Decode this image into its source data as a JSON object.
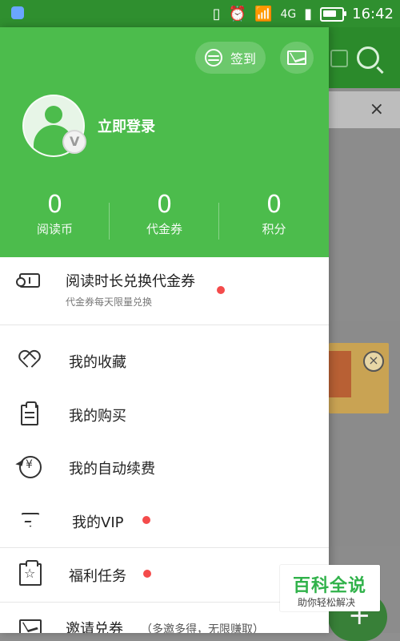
{
  "status_bar": {
    "network": "4G",
    "time": "16:42"
  },
  "drawer": {
    "sign_in_label": "签到",
    "login_label": "立即登录",
    "stats": [
      {
        "value": "0",
        "label": "阅读币"
      },
      {
        "value": "0",
        "label": "代金券"
      },
      {
        "value": "0",
        "label": "积分"
      }
    ],
    "menu": {
      "exchange": {
        "title": "阅读时长兑换代金券",
        "subtitle": "代金券每天限量兑换"
      },
      "items": [
        {
          "label": "我的收藏"
        },
        {
          "label": "我的购买"
        },
        {
          "label": "我的自动续费"
        },
        {
          "label": "我的VIP"
        },
        {
          "label": "福利任务"
        },
        {
          "label": "邀请兑券",
          "note": "（多邀多得，无限赚取）"
        }
      ]
    }
  },
  "background": {
    "close_label": "×"
  },
  "watermark": {
    "title": "百科全说",
    "subtitle": "助你轻松解决"
  },
  "colors": {
    "brand_green": "#4cbc4c",
    "dark_green": "#2f8f2f",
    "dot_red": "#f44b4b"
  }
}
